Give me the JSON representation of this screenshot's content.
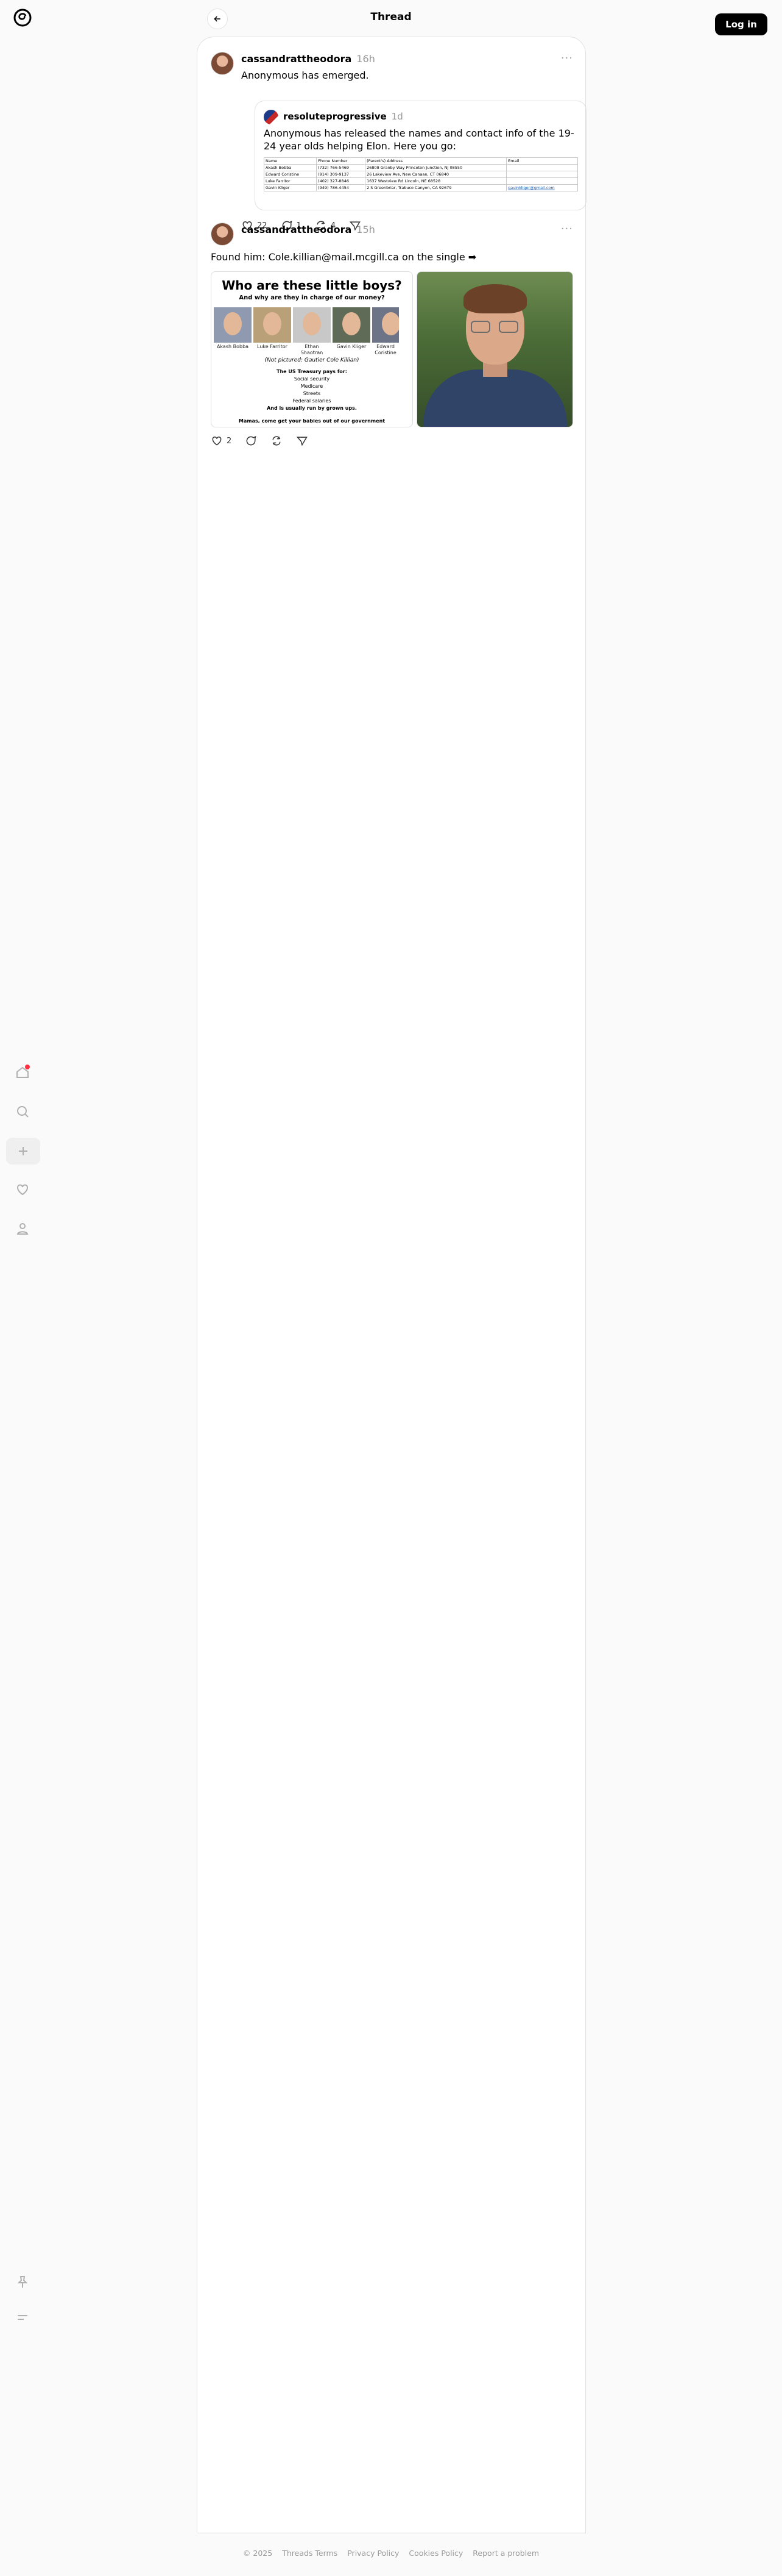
{
  "header": {
    "title": "Thread",
    "login_label": "Log in"
  },
  "nav": {
    "logo": "threads-logo-icon",
    "items": [
      "home-icon",
      "search-icon",
      "create-icon",
      "activity-icon",
      "profile-icon"
    ],
    "bottom": [
      "pin-icon",
      "menu-icon"
    ],
    "notification_color": "#ff3040"
  },
  "posts": [
    {
      "author": "cassandrattheodora",
      "time": "16h",
      "text": "Anonymous has emerged.",
      "quote": {
        "author": "resoluteprogressive",
        "time": "1d",
        "text": "Anonymous has released the names and contact info of the 19-24 year olds helping Elon. Here you go:",
        "table": {
          "headers": [
            "Name",
            "Phone Number",
            "(Parent's) Address",
            "Email"
          ],
          "rows": [
            [
              "Akash Bobba",
              "(732) 766-5469",
              "26808 Granby Way Princeton Junction, NJ 08550",
              ""
            ],
            [
              "Edward Coristine",
              "(914) 309-9137",
              "26 Lakeview Ave, New Canaan, CT 06840",
              ""
            ],
            [
              "Luke Farritor",
              "(402) 327-8846",
              "1637 Westview Rd Lincoln, NE 68528",
              ""
            ],
            [
              "Gavin Kliger",
              "(949) 786-4454",
              "2 S Greenbriar, Trabuco Canyon, CA 92679",
              "gavinkliger@gmail.com"
            ]
          ]
        }
      },
      "likes": "22",
      "replies": "1",
      "reposts": "4"
    },
    {
      "author": "cassandrattheodora",
      "time": "15h",
      "text": "Found him: Cole.killian@mail.mcgill.ca on the single ➡",
      "image1": {
        "title": "Who are these little boys?",
        "subtitle": "And why are they in charge of our money?",
        "people": [
          "Akash Bobba",
          "Luke Farritor",
          "Ethan Shaotran",
          "Gavin Kliger",
          "Edward Coristine"
        ],
        "note": "(Not pictured: Gautier Cole Killian)",
        "lines_title": "The US Treasury pays for:",
        "lines": [
          "Social security",
          "Medicare",
          "Streets",
          "Federal salaries"
        ],
        "lines_emphasis": "And is usually run by grown ups.",
        "footer": "Mamas, come get your babies out of our government"
      },
      "likes": "2"
    }
  ],
  "footer": {
    "copyright": "© 2025",
    "links": [
      "Threads Terms",
      "Privacy Policy",
      "Cookies Policy",
      "Report a problem"
    ]
  }
}
